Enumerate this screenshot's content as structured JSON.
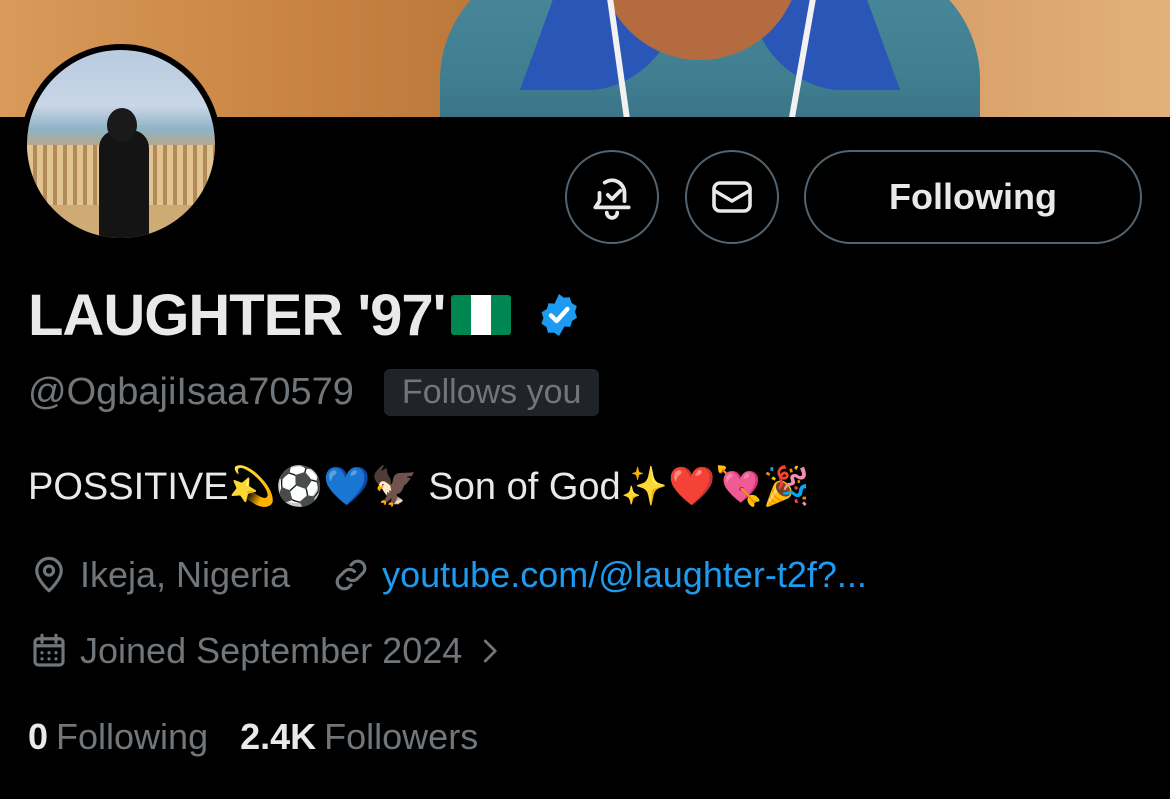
{
  "profile": {
    "display_name": "LAUGHTER '97'",
    "handle": "@OgbajiIsaa70579",
    "follows_you_label": "Follows you",
    "bio": "POSSITIVE💫⚽💙🦅 Son of God✨❤️💘🎉",
    "location": "Ikeja, Nigeria",
    "link": "youtube.com/@laughter-t2f?...",
    "joined": "Joined September 2024",
    "following_count": "0",
    "following_label": "Following",
    "followers_count": "2.4K",
    "followers_label": "Followers"
  },
  "actions": {
    "follow_button_label": "Following"
  },
  "icons": {
    "notify": "bell-check-icon",
    "message": "envelope-icon",
    "location": "location-pin-icon",
    "link": "link-icon",
    "calendar": "calendar-icon",
    "chevron": "chevron-right-icon",
    "verified": "verified-badge-icon",
    "flag": "nigeria-flag-icon"
  },
  "colors": {
    "background": "#000000",
    "text_primary": "#e7e9ea",
    "text_secondary": "#71767b",
    "link": "#1d9bf0",
    "verified": "#1d9bf0",
    "border": "#536471"
  }
}
